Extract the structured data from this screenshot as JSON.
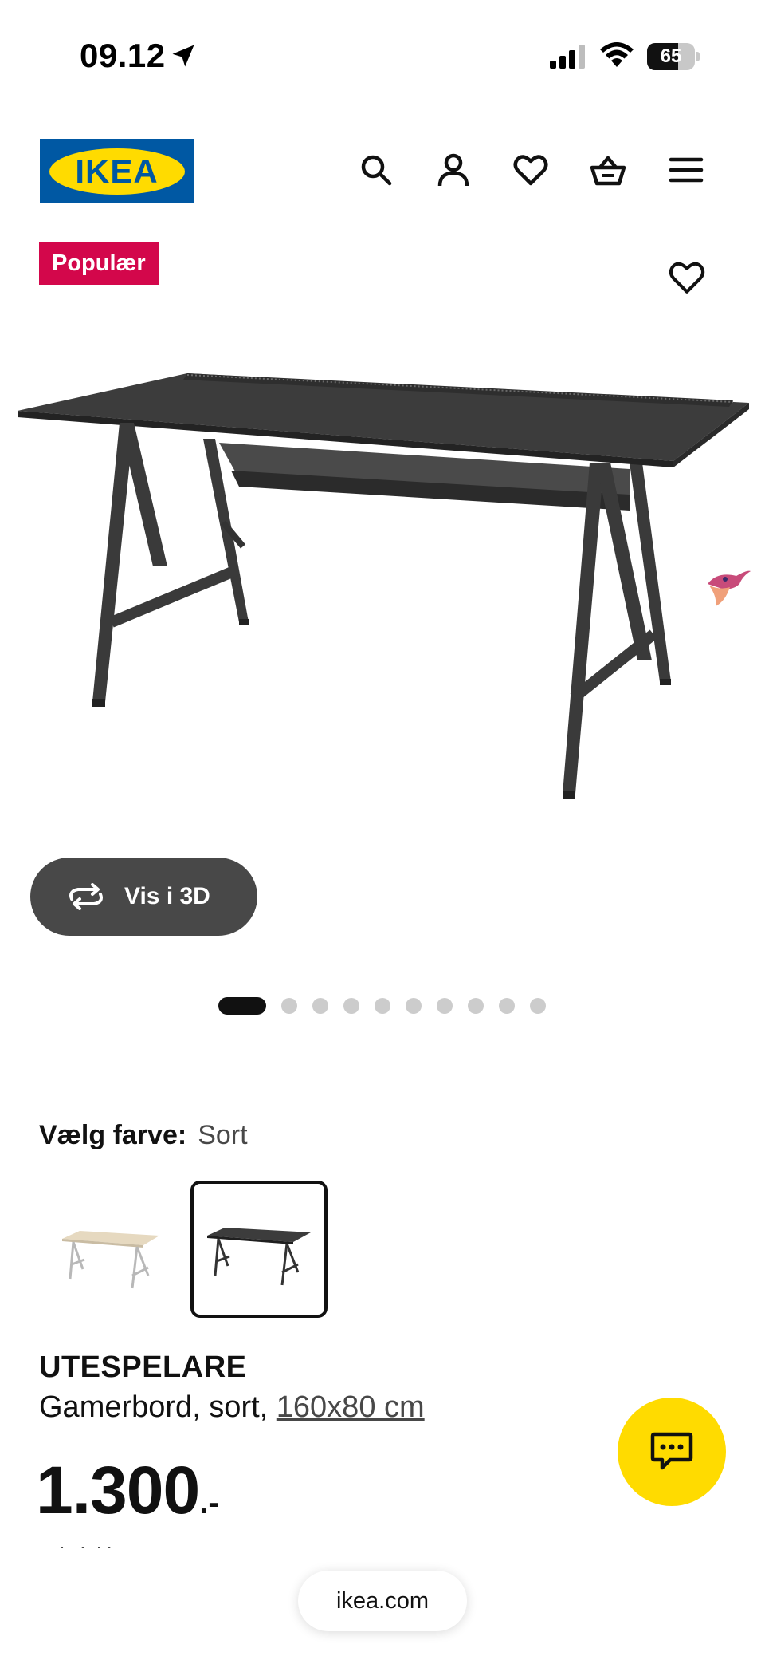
{
  "status_bar": {
    "time": "09.12",
    "battery": "65",
    "battery_level": 0.65
  },
  "header": {
    "logo_text": "IKEA",
    "icons": [
      "search-icon",
      "account-icon",
      "favorites-icon",
      "basket-icon",
      "menu-icon"
    ]
  },
  "product": {
    "badge": "Populær",
    "view_3d_label": "Vis i 3D",
    "image_count": 10,
    "active_image": 1,
    "color_label": "Vælg farve:",
    "color_value": "Sort",
    "swatches": [
      "white-variant",
      "black-variant"
    ],
    "name": "UTESPELARE",
    "description": "Gamerbord, sort,",
    "size": "160x80 cm",
    "price": "1.300",
    "price_suffix": ".-",
    "price_note": "Pris inkl. moms"
  },
  "browser": {
    "url": "ikea.com"
  },
  "colors": {
    "brand_blue": "#0058a3",
    "brand_yellow": "#ffdb00",
    "badge_red": "#d3074b",
    "dark_button": "#484848"
  }
}
